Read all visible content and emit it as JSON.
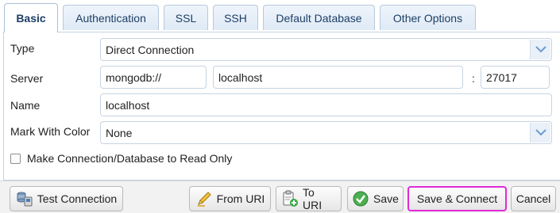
{
  "tabs": [
    {
      "label": "Basic",
      "active": true
    },
    {
      "label": "Authentication",
      "active": false
    },
    {
      "label": "SSL",
      "active": false
    },
    {
      "label": "SSH",
      "active": false
    },
    {
      "label": "Default Database",
      "active": false
    },
    {
      "label": "Other Options",
      "active": false
    }
  ],
  "form": {
    "type_label": "Type",
    "type_value": "Direct Connection",
    "server_label": "Server",
    "server_scheme": "mongodb://",
    "server_host": "localhost",
    "port_separator": ":",
    "server_port": "27017",
    "name_label": "Name",
    "name_value": "localhost",
    "color_label": "Mark With Color",
    "color_value": "None",
    "readonly_label": "Make Connection/Database to Read Only",
    "readonly_checked": false
  },
  "buttons": {
    "test_connection": "Test Connection",
    "from_uri": "From URI",
    "to_uri": "To URI",
    "save": "Save",
    "save_connect": "Save & Connect",
    "cancel": "Cancel"
  },
  "icons": {
    "test_connection": "database-connection-icon",
    "from_uri": "pencil-icon",
    "to_uri": "clipboard-add-icon",
    "save": "checkmark-circle-icon",
    "select_arrow": "chevron-down-icon"
  },
  "colors": {
    "highlight_border": "#e02ad6",
    "tab_text": "#1c3f66"
  }
}
